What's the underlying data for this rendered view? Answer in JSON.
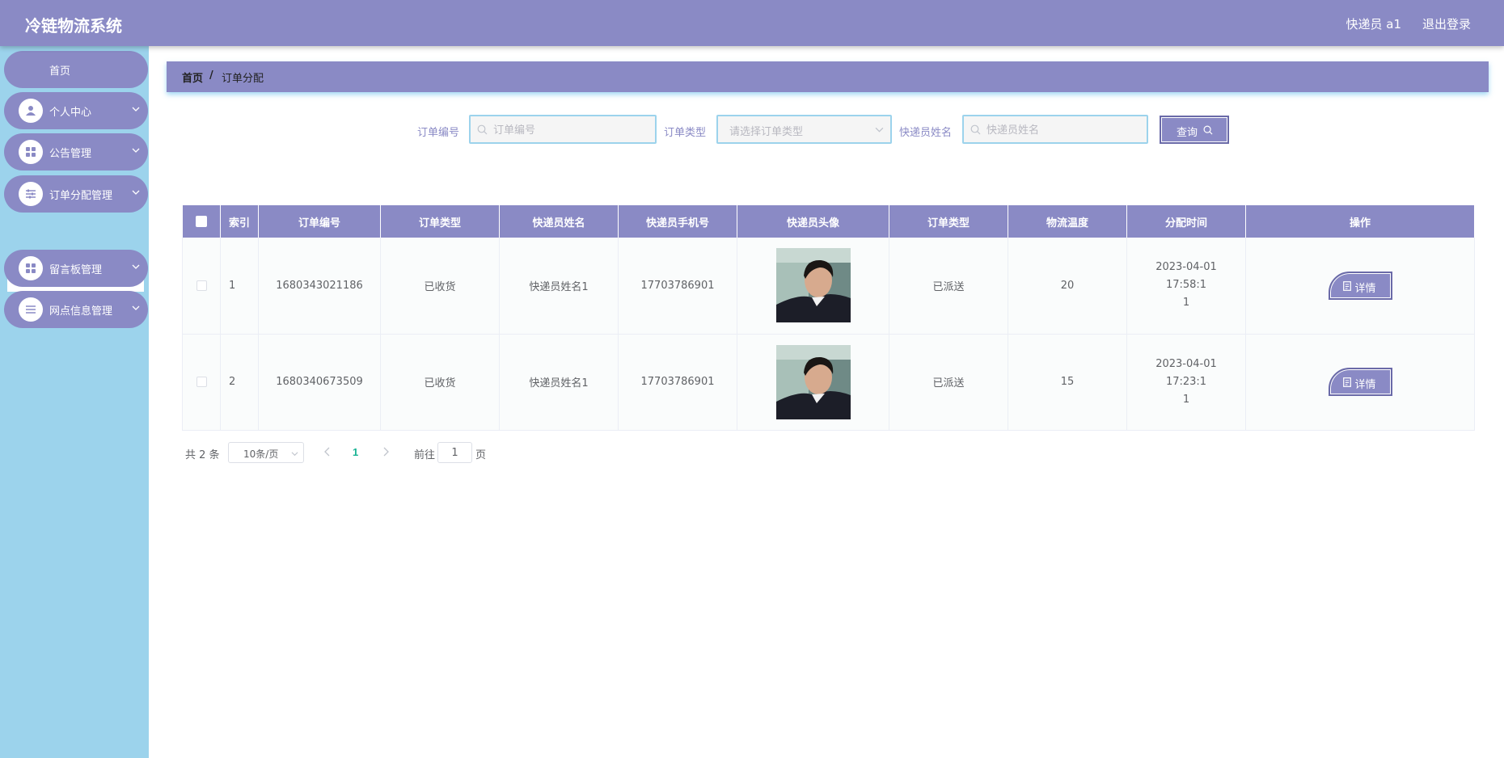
{
  "header": {
    "app_title": "冷链物流系统",
    "user": "快递员 a1",
    "logout": "退出登录"
  },
  "sidebar": {
    "items": [
      {
        "label": "首页",
        "icon": "home"
      },
      {
        "label": "个人中心",
        "icon": "user-icon"
      },
      {
        "label": "公告管理",
        "icon": "grid-icon"
      },
      {
        "label": "订单分配管理",
        "icon": "sliders-icon"
      },
      {
        "label": "留言板管理",
        "icon": "grid-icon"
      },
      {
        "label": "网点信息管理",
        "icon": "list-icon"
      }
    ],
    "submenu": {
      "label": "订单分配管理"
    }
  },
  "breadcrumb": {
    "home": "首页",
    "separator": "/",
    "current": "订单分配"
  },
  "search": {
    "order_no_label": "订单编号",
    "order_no_placeholder": "订单编号",
    "order_type_label": "订单类型",
    "order_type_placeholder": "请选择订单类型",
    "courier_name_label": "快递员姓名",
    "courier_name_placeholder": "快递员姓名",
    "query_button": "查询"
  },
  "table": {
    "columns": [
      "索引",
      "订单编号",
      "订单类型",
      "快递员姓名",
      "快递员手机号",
      "快递员头像",
      "订单类型",
      "物流温度",
      "分配时间",
      "操作"
    ],
    "rows": [
      {
        "index": "1",
        "order_no": "1680343021186",
        "order_type": "已收货",
        "courier_name": "快递员姓名1",
        "courier_phone": "17703786901",
        "order_status": "已派送",
        "temperature": "20",
        "time_line1": "2023-04-01 17:58:1",
        "time_line2": "1",
        "action": "详情"
      },
      {
        "index": "2",
        "order_no": "1680340673509",
        "order_type": "已收货",
        "courier_name": "快递员姓名1",
        "courier_phone": "17703786901",
        "order_status": "已派送",
        "temperature": "15",
        "time_line1": "2023-04-01 17:23:1",
        "time_line2": "1",
        "action": "详情"
      }
    ]
  },
  "pagination": {
    "total": "共 2 条",
    "page_size": "10条/页",
    "current_page": "1",
    "goto_label": "前往",
    "goto_value": "1",
    "page_suffix": "页"
  },
  "colors": {
    "primary": "#8a8ac5",
    "sidebar_bg": "#9cd3ec",
    "active_page": "#19b394"
  }
}
